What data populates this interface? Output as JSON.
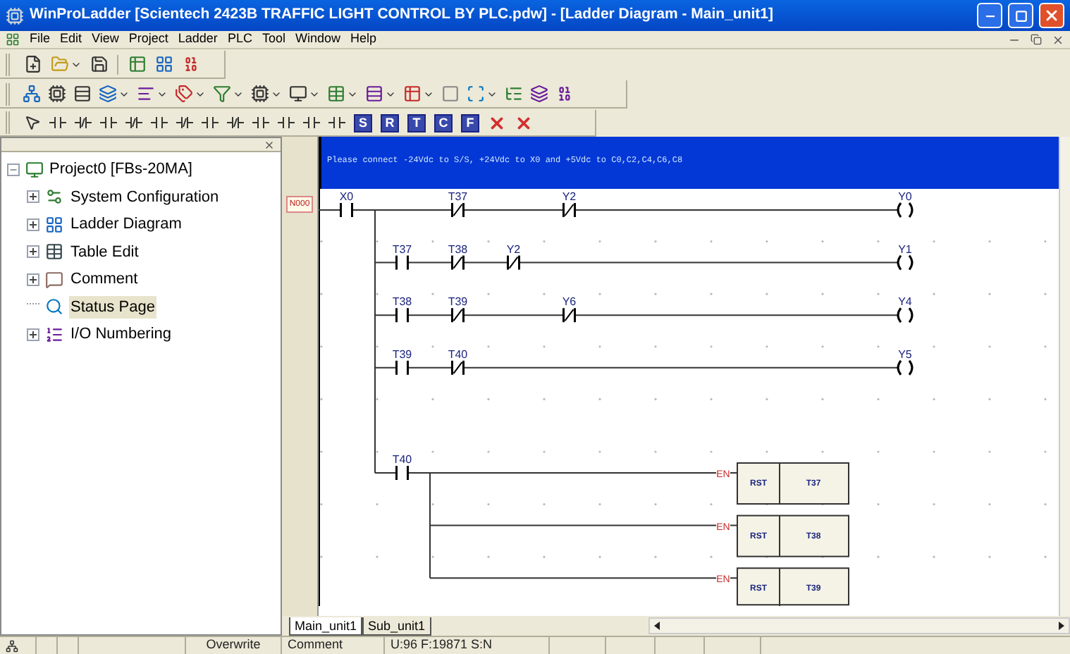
{
  "window": {
    "title": "WinProLadder [Scientech 2423B TRAFFIC LIGHT CONTROL BY PLC.pdw] - [Ladder Diagram - Main_unit1]"
  },
  "menu": [
    "File",
    "Edit",
    "View",
    "Project",
    "Ladder",
    "PLC",
    "Tool",
    "Window",
    "Help"
  ],
  "instruction_tools": [
    "S",
    "R",
    "T",
    "C",
    "F"
  ],
  "tree": {
    "label": "Project0 [FBs-20MA]",
    "expanded": true,
    "children": [
      {
        "label": "System Configuration",
        "kind": "config",
        "expanded": false,
        "selected": false
      },
      {
        "label": "Ladder Diagram",
        "kind": "ladder",
        "expanded": false,
        "selected": false
      },
      {
        "label": "Table Edit",
        "kind": "table",
        "expanded": false,
        "selected": false
      },
      {
        "label": "Comment",
        "kind": "comment",
        "expanded": false,
        "selected": false
      },
      {
        "label": "Status Page",
        "kind": "status",
        "selected": true
      },
      {
        "label": "I/O Numbering",
        "kind": "io",
        "expanded": false,
        "selected": false
      }
    ]
  },
  "ladder": {
    "network": "N000",
    "comment": "Please connect -24Vdc to S/S, +24Vdc to X0 and +5Vdc to C0,C2,C4,C6,C8",
    "rungs": [
      {
        "contacts": [
          {
            "kind": "no",
            "label": "X0"
          },
          {
            "kind": "nc",
            "label": "T37"
          },
          {
            "kind": "nc",
            "label": "Y2"
          }
        ],
        "coil": "Y0"
      },
      {
        "contacts": [
          {
            "kind": "no",
            "label": "T37"
          },
          {
            "kind": "nc",
            "label": "T38"
          },
          {
            "kind": "nc",
            "label": "Y2"
          }
        ],
        "coil": "Y1"
      },
      {
        "contacts": [
          {
            "kind": "no",
            "label": "T38"
          },
          {
            "kind": "nc",
            "label": "T39"
          },
          {
            "kind": "nc",
            "label": "Y6"
          }
        ],
        "coil": "Y4"
      },
      {
        "contacts": [
          {
            "kind": "no",
            "label": "T39"
          },
          {
            "kind": "nc",
            "label": "T40"
          }
        ],
        "coil": "Y5"
      }
    ],
    "reset_rung": {
      "contact": {
        "kind": "no",
        "label": "T40"
      },
      "outputs": [
        {
          "input": "EN",
          "instruction": "RST",
          "operand": "T37"
        },
        {
          "input": "EN",
          "instruction": "RST",
          "operand": "T38"
        },
        {
          "input": "EN",
          "instruction": "RST",
          "operand": "T39"
        }
      ]
    }
  },
  "tabs": [
    {
      "label": "Main_unit1",
      "selected": true
    },
    {
      "label": "Sub_unit1",
      "selected": false
    }
  ],
  "status_bar": {
    "mode": "Overwrite",
    "view": "Comment",
    "memory": "U:96 F:19871 S:N"
  }
}
